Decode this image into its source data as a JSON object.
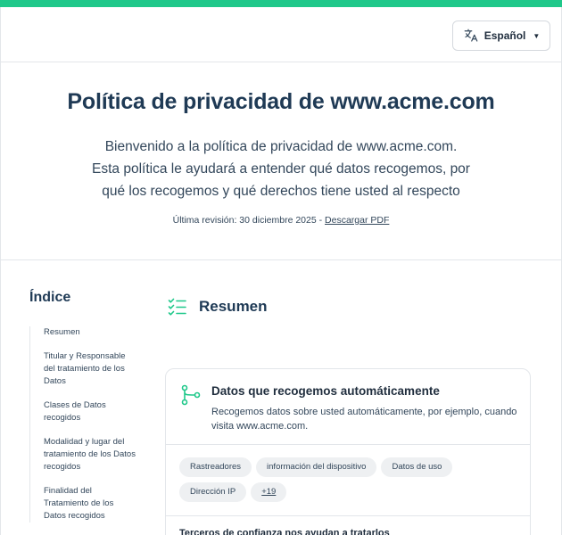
{
  "header": {
    "language_label": "Español"
  },
  "hero": {
    "title": "Política de privacidad de www.acme.com",
    "intro_lines": [
      "Bienvenido a la política de privacidad de www.acme.com.",
      "Esta política le ayudará a entender qué datos recogemos, por",
      "qué los recogemos y qué derechos tiene usted al respecto"
    ],
    "revision_text": "Última revisión: 30 diciembre 2025 - ",
    "download_label": "Descargar PDF"
  },
  "toc": {
    "title": "Índice",
    "items": [
      "Resumen",
      "Titular y Responsable del tratamiento de los Datos",
      "Clases de Datos recogidos",
      "Modalidad y lugar del tratamiento de los Datos recogidos",
      "Finalidad del Tratamiento de los Datos recogidos"
    ]
  },
  "summary": {
    "title": "Resumen",
    "card": {
      "title": "Datos que recogemos automáticamente",
      "description": "Recogemos datos sobre usted automáticamente, por ejemplo, cuando visita www.acme.com.",
      "chips": [
        "Rastreadores",
        "información del dispositivo",
        "Datos de uso",
        "Dirección IP"
      ],
      "more_label": "+19",
      "footer_text": "Terceros de confianza nos ayudan a tratarlos"
    }
  },
  "colors": {
    "accent": "#1fc88a",
    "heading": "#1f3a55",
    "border": "#e3e6ea"
  }
}
